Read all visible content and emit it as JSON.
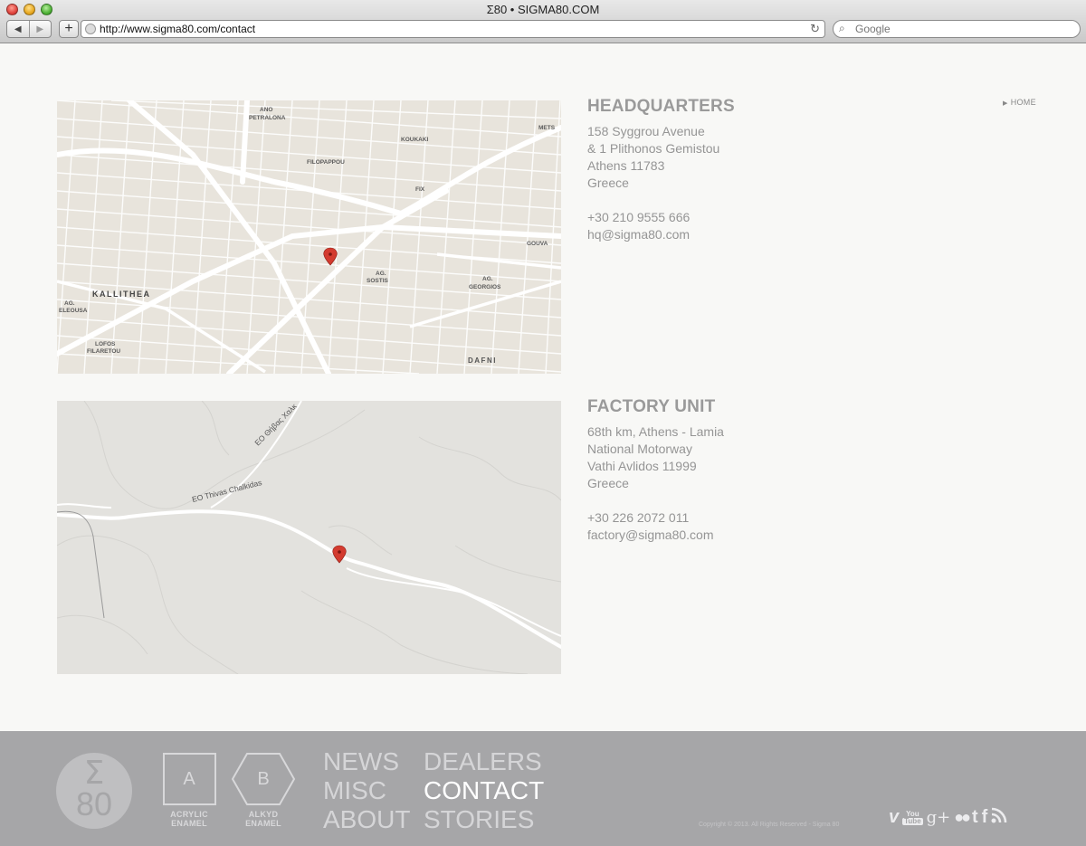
{
  "browser": {
    "window_title": "Σ80 • SIGMA80.COM",
    "url": "http://www.sigma80.com/contact",
    "search_placeholder": "Google",
    "back_glyph": "◀",
    "forward_glyph": "▶",
    "add_glyph": "+",
    "reload_glyph": "↻",
    "search_glyph": "🔍"
  },
  "nav": {
    "home_label": "HOME",
    "home_marker": "▶"
  },
  "headquarters": {
    "title": "HEADQUARTERS",
    "address": [
      "158 Syggrou Avenue",
      "& 1 Plithonos Gemistou",
      "Athens 11783",
      "Greece"
    ],
    "phone": "+30 210 9555 666",
    "email": "hq@sigma80.com",
    "map_labels": {
      "ano_petralona_1": "ANO",
      "ano_petralona_2": "PETRALONA",
      "koukaki": "KOUKAKI",
      "filopappou": "FILOPAPPOU",
      "mets": "METS",
      "fix": "FIX",
      "kallithea": "KALLITHEA",
      "gouva": "GOUVA",
      "ag_sostis_1": "AG.",
      "ag_sostis_2": "SOSTIS",
      "ag_georgios_1": "AG.",
      "ag_georgios_2": "GEORGIOS",
      "ag_elefsa_1": "AG.",
      "ag_elefsa_2": "ELEOUSA",
      "lofos_1": "LOFOS",
      "lofos_2": "FILARETOU",
      "dafni": "DAFNI"
    }
  },
  "factory": {
    "title": "FACTORY UNIT",
    "address": [
      "68th km, Athens - Lamia",
      "National Motorway",
      "Vathi Avlidos 11999",
      "Greece"
    ],
    "phone": "+30 226 2072 011",
    "email": "factory@sigma80.com",
    "map_labels": {
      "road_1": "EO Thivas Chalkidas",
      "road_2": "ΕΟ Θήβας Χαλκ"
    }
  },
  "footer": {
    "logo_sigma": "Σ",
    "logo_number": "80",
    "product_a": {
      "letter": "A",
      "line1": "ACRYLIC",
      "line2": "ENAMEL"
    },
    "product_b": {
      "letter": "B",
      "line1": "ALKYD",
      "line2": "ENAMEL"
    },
    "menu_col1": [
      "NEWS",
      "MISC",
      "ABOUT"
    ],
    "menu_col2": [
      "DEALERS",
      "CONTACT",
      "STORIES"
    ],
    "copyright": "Copyright © 2013. All Rights Reserved - Sigma 80",
    "social_icons": [
      "vimeo-icon",
      "youtube-icon",
      "google-plus-icon",
      "flickr-icon",
      "tumblr-icon",
      "facebook-icon",
      "rss-icon"
    ]
  }
}
